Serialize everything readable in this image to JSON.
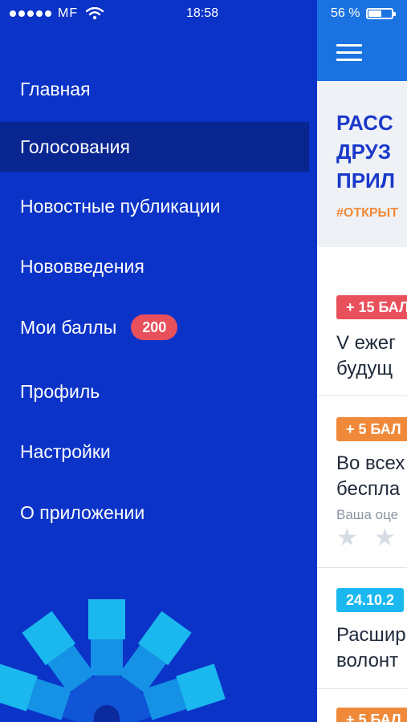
{
  "status_bar": {
    "carrier": "MF",
    "time": "18:58",
    "battery": "56 %",
    "battery_level": 0.56
  },
  "drawer": {
    "items": [
      {
        "label": "Главная",
        "active": false
      },
      {
        "label": "Голосования",
        "active": true
      },
      {
        "label": "Новостные публикации",
        "active": false
      },
      {
        "label": "Нововведения",
        "active": false
      },
      {
        "label": "Мои баллы",
        "badge": "200",
        "active": false
      },
      {
        "label": "Профиль",
        "active": false
      },
      {
        "label": "Настройки",
        "active": false
      },
      {
        "label": "О приложении",
        "active": false
      }
    ]
  },
  "main": {
    "promo": {
      "title_lines": [
        "РАСС",
        "ДРУЗ",
        "ПРИЛ"
      ],
      "tag": "#ОТКРЫТ"
    },
    "cards": [
      {
        "badge": "+ 15 БАЛ",
        "badge_color": "#e8505b",
        "title_lines": [
          "V ежег",
          "будущ"
        ]
      },
      {
        "badge": "+ 5 БАЛ",
        "badge_color": "#f08a3a",
        "title_lines": [
          "Во всех",
          "беспла"
        ],
        "sub": "Ваша оце"
      },
      {
        "badge": "24.10.2",
        "badge_color": "#1ab8ee",
        "title_lines": [
          "Расшир",
          "волонт"
        ]
      },
      {
        "badge": "+ 5 БАЛ",
        "badge_color": "#f08a3a"
      }
    ]
  },
  "colors": {
    "drawer_bg": "#0b33c8",
    "active_item_bg": "#082590",
    "header_bg": "#1a73e0",
    "accent_red": "#e8505b",
    "accent_orange": "#f08a3a",
    "accent_cyan": "#1ab8ee"
  },
  "icons": [
    "signal-dots-icon",
    "wifi-icon",
    "battery-icon",
    "hamburger-menu-icon",
    "star-icon",
    "emblem-logo"
  ]
}
